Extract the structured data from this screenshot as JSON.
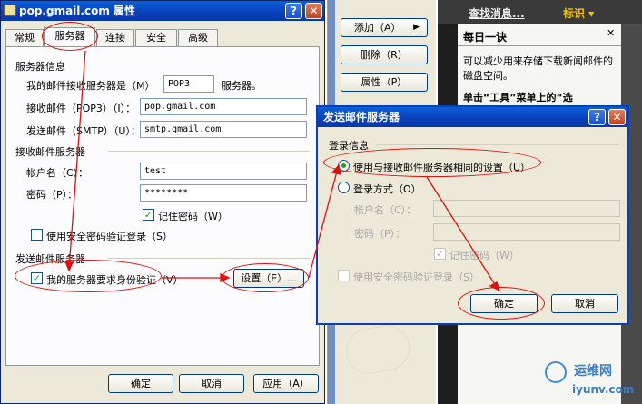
{
  "props_dialog": {
    "title": "pop.gmail.com 属性",
    "help_btn": "?",
    "close_btn": "✕",
    "tabs": [
      "常规",
      "服务器",
      "连接",
      "安全",
      "高级"
    ],
    "server_info_heading": "服务器信息",
    "incoming_type_label": "我的邮件接收服务器是（M）",
    "incoming_type_value": "POP3",
    "incoming_type_suffix": "服务器。",
    "incoming_label": "接收邮件（POP3）（I）：",
    "incoming_value": "pop.gmail.com",
    "outgoing_label": "发送邮件（SMTP）（U）：",
    "outgoing_value": "smtp.gmail.com",
    "incoming_server_heading": "接收邮件服务器",
    "account_label": "帐户名（C）：",
    "account_value": "test",
    "password_label": "密码（P）：",
    "password_value": "********",
    "remember_label": "记住密码（W）",
    "spa_label": "使用安全密码验证登录（S）",
    "outgoing_server_heading": "发送邮件服务器",
    "auth_label": "我的服务器要求身份验证（V）",
    "settings_btn": "设置（E）...",
    "ok_btn": "确定",
    "cancel_btn": "取消",
    "apply_btn": "应用（A）"
  },
  "middle_panel": {
    "add_btn": "添加（A）",
    "add_arrow": "▶",
    "remove_btn": "删除（R）",
    "properties_btn": "属性（P）"
  },
  "right_pane": {
    "find_messages": "查找消息...",
    "identity": "标识 ▾",
    "tip_title": "每日一诀",
    "tip_close": "✕",
    "tip_text": "可以减少用来存储下载新闻邮件的磁盘空间。",
    "tip_text2": "单击“工具”菜单上的“选"
  },
  "smtp_dialog": {
    "title": "发送邮件服务器",
    "help_btn": "?",
    "close_btn": "✕",
    "logon_heading": "登录信息",
    "same_settings_label": "使用与接收邮件服务器相同的设置（U）",
    "logon_using_label": "登录方式（O）",
    "account_label": "帐户名（C）：",
    "password_label": "密码（P）：",
    "remember_label": "记住密码（W）",
    "spa_label": "使用安全密码验证登录（S）",
    "ok_btn": "确定",
    "cancel_btn": "取消"
  },
  "watermark": {
    "line1": "运维网",
    "line2": "iyunv.com"
  },
  "colors": {
    "title_blue": "#0a3fb8",
    "annotation_red": "#e01010",
    "dialog_bg": "#ece9d8"
  }
}
